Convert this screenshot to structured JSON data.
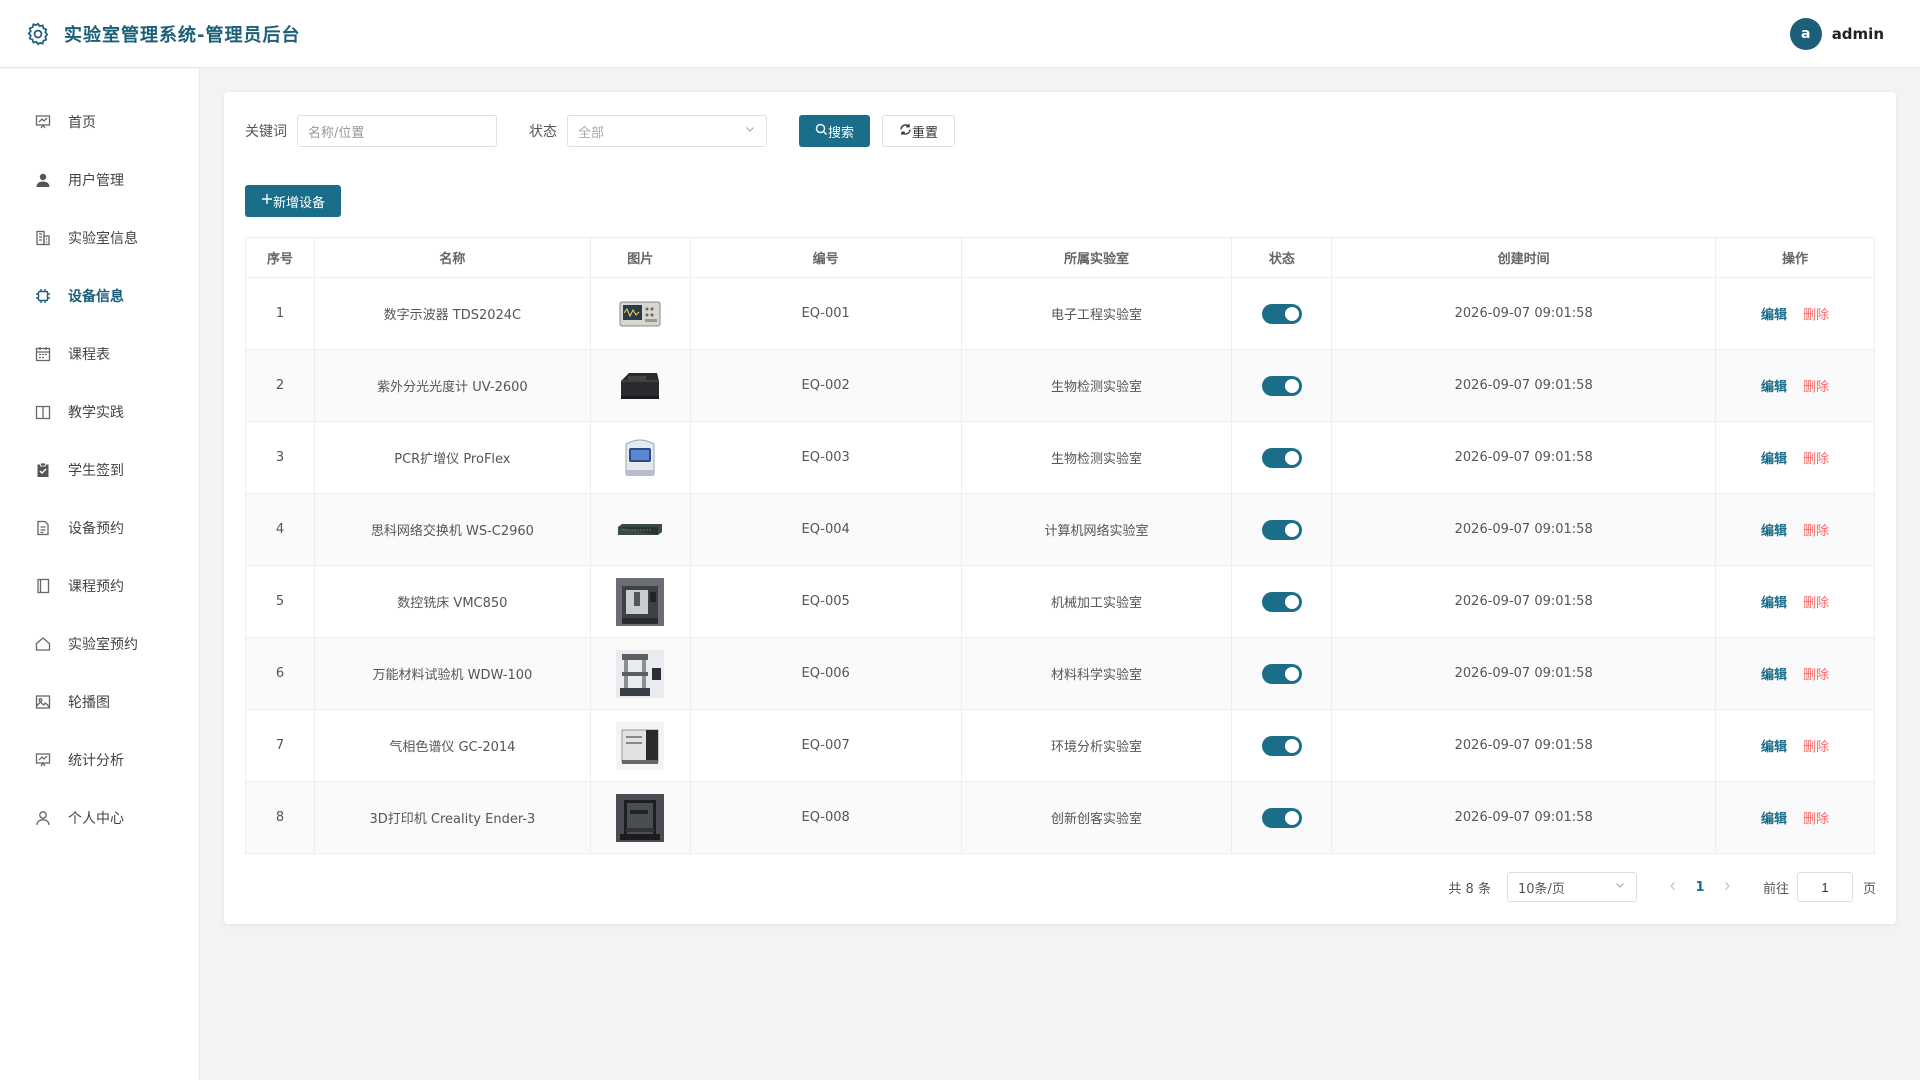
{
  "header": {
    "title": "实验室管理系统-管理员后台",
    "user_initial": "a",
    "username": "admin"
  },
  "sidebar": {
    "items": [
      {
        "label": "首页",
        "icon": "dashboard-icon"
      },
      {
        "label": "用户管理",
        "icon": "user-icon"
      },
      {
        "label": "实验室信息",
        "icon": "building-icon"
      },
      {
        "label": "设备信息",
        "icon": "chip-icon",
        "active": true
      },
      {
        "label": "课程表",
        "icon": "calendar-icon"
      },
      {
        "label": "教学实践",
        "icon": "book-icon"
      },
      {
        "label": "学生签到",
        "icon": "checklist-icon"
      },
      {
        "label": "设备预约",
        "icon": "document-icon"
      },
      {
        "label": "课程预约",
        "icon": "notebook-icon"
      },
      {
        "label": "实验室预约",
        "icon": "house-icon"
      },
      {
        "label": "轮播图",
        "icon": "picture-icon"
      },
      {
        "label": "统计分析",
        "icon": "chart-icon"
      },
      {
        "label": "个人中心",
        "icon": "person-icon"
      }
    ]
  },
  "filters": {
    "keyword_label": "关键词",
    "keyword_placeholder": "名称/位置",
    "status_label": "状态",
    "status_value": "全部",
    "search_label": "搜索",
    "reset_label": "重置"
  },
  "add_label": "新增设备",
  "table": {
    "headers": [
      "序号",
      "名称",
      "图片",
      "编号",
      "所属实验室",
      "状态",
      "创建时间",
      "操作"
    ],
    "edit_label": "编辑",
    "delete_label": "删除",
    "rows": [
      {
        "index": "1",
        "name": "数字示波器 TDS2024C",
        "code": "EQ-001",
        "lab": "电子工程实验室",
        "enabled": true,
        "created": "2026-09-07 09:01:58",
        "image": "oscilloscope"
      },
      {
        "index": "2",
        "name": "紫外分光光度计 UV-2600",
        "code": "EQ-002",
        "lab": "生物检测实验室",
        "enabled": true,
        "created": "2026-09-07 09:01:58",
        "image": "spectrophotometer"
      },
      {
        "index": "3",
        "name": "PCR扩增仪 ProFlex",
        "code": "EQ-003",
        "lab": "生物检测实验室",
        "enabled": true,
        "created": "2026-09-07 09:01:58",
        "image": "pcr"
      },
      {
        "index": "4",
        "name": "思科网络交换机 WS-C2960",
        "code": "EQ-004",
        "lab": "计算机网络实验室",
        "enabled": true,
        "created": "2026-09-07 09:01:58",
        "image": "switch"
      },
      {
        "index": "5",
        "name": "数控铣床 VMC850",
        "code": "EQ-005",
        "lab": "机械加工实验室",
        "enabled": true,
        "created": "2026-09-07 09:01:58",
        "image": "cnc"
      },
      {
        "index": "6",
        "name": "万能材料试验机 WDW-100",
        "code": "EQ-006",
        "lab": "材料科学实验室",
        "enabled": true,
        "created": "2026-09-07 09:01:58",
        "image": "tester"
      },
      {
        "index": "7",
        "name": "气相色谱仪 GC-2014",
        "code": "EQ-007",
        "lab": "环境分析实验室",
        "enabled": true,
        "created": "2026-09-07 09:01:58",
        "image": "gc"
      },
      {
        "index": "8",
        "name": "3D打印机 Creality Ender-3",
        "code": "EQ-008",
        "lab": "创新创客实验室",
        "enabled": true,
        "created": "2026-09-07 09:01:58",
        "image": "printer"
      }
    ]
  },
  "pagination": {
    "total": "共 8 条",
    "page_size": "10条/页",
    "current_page": "1",
    "goto_label": "前往",
    "goto_value": "1",
    "page_suffix": "页"
  }
}
